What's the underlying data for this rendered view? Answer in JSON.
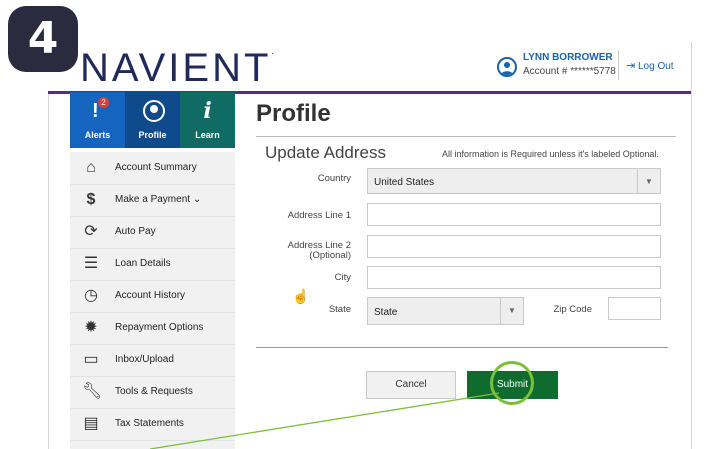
{
  "step_number": "4",
  "header": {
    "logo_text": "NAVIENT",
    "logo_tm": ".",
    "user_name": "LYNN BORROWER",
    "account": "Account # ******5778",
    "logout_label": "Log Out",
    "rule_color": "#582c83"
  },
  "topnav": {
    "alerts_label": "Alerts",
    "alerts_count": "2",
    "profile_label": "Profile",
    "learn_label": "Learn"
  },
  "sidebar": {
    "items": [
      {
        "label": "Account Summary",
        "icon": "home-icon"
      },
      {
        "label": "Make a Payment ⌄",
        "icon": "dollar-icon"
      },
      {
        "label": "Auto Pay",
        "icon": "autopay-icon"
      },
      {
        "label": "Loan Details",
        "icon": "list-icon"
      },
      {
        "label": "Account History",
        "icon": "clock-icon"
      },
      {
        "label": "Repayment Options",
        "icon": "gear-icon"
      },
      {
        "label": "Inbox/Upload",
        "icon": "inbox-icon"
      },
      {
        "label": "Tools & Requests",
        "icon": "wrench-icon"
      },
      {
        "label": "Tax Statements",
        "icon": "document-icon"
      }
    ]
  },
  "main": {
    "title": "Profile",
    "section_title": "Update Address",
    "required_note": "All information is Required unless it's labeled Optional.",
    "form": {
      "country_label": "Country",
      "country_value": "United States",
      "address1_label": "Address Line 1",
      "address1_value": "",
      "address2_label": "Address Line 2",
      "address2_optional": "(Optional)",
      "address2_value": "",
      "city_label": "City",
      "city_value": "",
      "state_label": "State",
      "state_value": "State",
      "zip_label": "Zip Code",
      "zip_value": ""
    },
    "cancel_label": "Cancel",
    "submit_label": "Submit"
  },
  "colors": {
    "alerts_bg": "#1565c0",
    "profile_bg": "#0e4a8c",
    "learn_bg": "#0f6b64",
    "submit_bg": "#0f6b2e",
    "highlight": "#7dbf3a"
  }
}
